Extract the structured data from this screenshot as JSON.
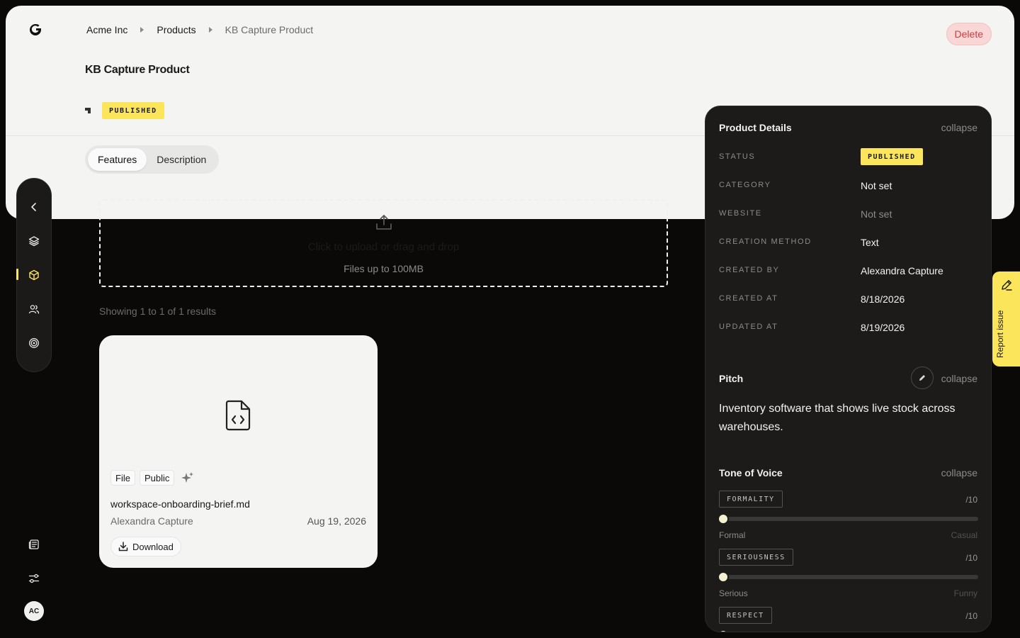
{
  "breadcrumb": {
    "org": "Acme Inc",
    "section": "Products",
    "current": "KB Capture Product"
  },
  "header": {
    "title": "KB Capture Product",
    "status_badge": "PUBLISHED",
    "delete_label": "Delete"
  },
  "tabs": [
    {
      "label": "Features",
      "active": true
    },
    {
      "label": "Description",
      "active": false
    }
  ],
  "upload": {
    "prompt": "Click to upload or drag and drop",
    "limit": "Files up to 100MB"
  },
  "results_text": "Showing 1 to 1 of 1 results",
  "file_card": {
    "type_chip": "File",
    "visibility_chip": "Public",
    "name": "workspace-onboarding-brief.md",
    "author": "Alexandra Capture",
    "date": "Aug 19, 2026",
    "download_label": "Download"
  },
  "user": {
    "initials": "AC"
  },
  "panel": {
    "details": {
      "title": "Product Details",
      "collapse": "collapse",
      "rows": [
        {
          "label": "STATUS",
          "value": "PUBLISHED"
        },
        {
          "label": "CATEGORY",
          "value": "Not set"
        },
        {
          "label": "WEBSITE",
          "value": "Not set"
        },
        {
          "label": "CREATION METHOD",
          "value": "Text"
        },
        {
          "label": "CREATED BY",
          "value": "Alexandra Capture"
        },
        {
          "label": "CREATED AT",
          "value": "8/18/2026"
        },
        {
          "label": "UPDATED AT",
          "value": "8/19/2026"
        }
      ]
    },
    "pitch": {
      "title": "Pitch",
      "collapse": "collapse",
      "text": "Inventory software that shows live stock across warehouses."
    },
    "tone": {
      "title": "Tone of Voice",
      "collapse": "collapse",
      "items": [
        {
          "label": "FORMALITY",
          "max": "/10",
          "left": "Formal",
          "right": "Casual",
          "level": 0
        },
        {
          "label": "SERIOUSNESS",
          "max": "/10",
          "left": "Serious",
          "right": "Funny",
          "level": 0
        },
        {
          "label": "RESPECT",
          "max": "/10",
          "level": 0
        }
      ]
    }
  },
  "report_issue": "Report issue",
  "colors": {
    "accent": "#fbe55a",
    "danger": "#d23b3b",
    "panel_bg": "#1c1b1a",
    "page_bg": "#0b0908"
  }
}
